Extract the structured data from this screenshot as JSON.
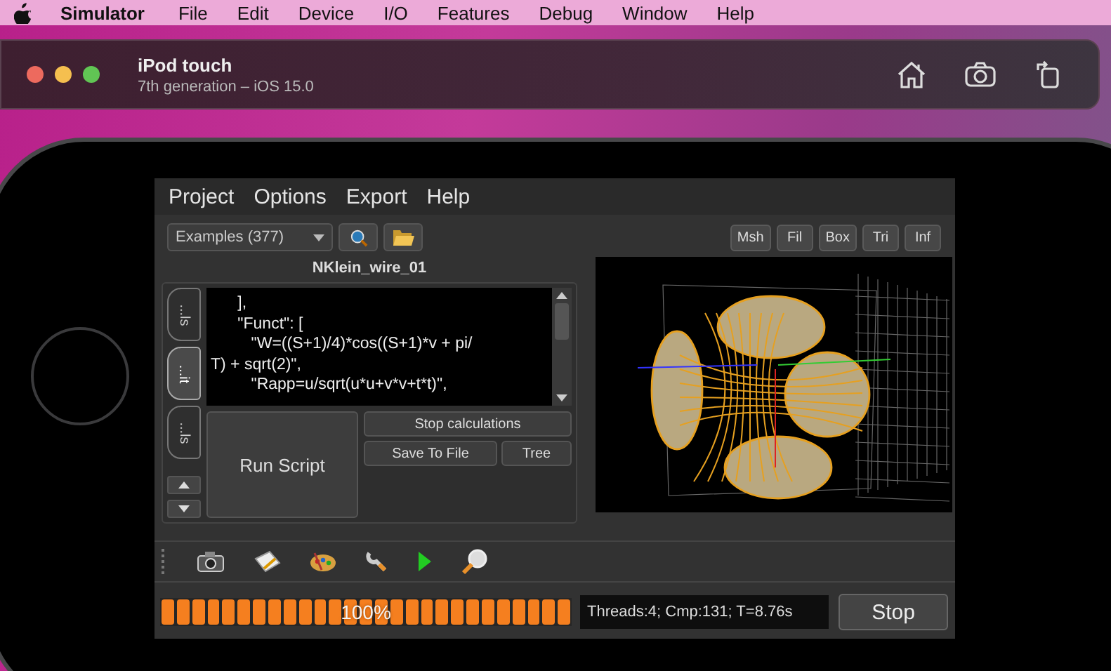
{
  "menubar": {
    "app": "Simulator",
    "items": [
      "File",
      "Edit",
      "Device",
      "I/O",
      "Features",
      "Debug",
      "Window",
      "Help"
    ]
  },
  "simulator": {
    "title": "iPod touch",
    "subtitle": "7th generation – iOS 15.0"
  },
  "app": {
    "menu": [
      "Project",
      "Options",
      "Export",
      "Help"
    ],
    "examples_dropdown": "Examples (377)",
    "view_buttons": [
      "Msh",
      "Fil",
      "Box",
      "Tri",
      "Inf"
    ],
    "script_title": "NKlein_wire_01",
    "side_tabs": [
      {
        "label": "...ls",
        "selected": false
      },
      {
        "label": "...it",
        "selected": true
      },
      {
        "label": "...ls",
        "selected": false
      }
    ],
    "code_lines": [
      "      ],",
      "      \"Funct\": [",
      "         \"W=((S+1)/4)*cos((S+1)*v + pi/",
      "T) + sqrt(2)\",",
      "         \"Rapp=u/sqrt(u*u+v*v+t*t)\","
    ],
    "run_button": "Run Script",
    "stop_calc_button": "Stop calculations",
    "save_button": "Save To File",
    "tree_button": "Tree",
    "progress": {
      "level": 1,
      "label": "100%"
    },
    "status": "Threads:4; Cmp:131; T=8.76s",
    "stop_button": "Stop"
  }
}
